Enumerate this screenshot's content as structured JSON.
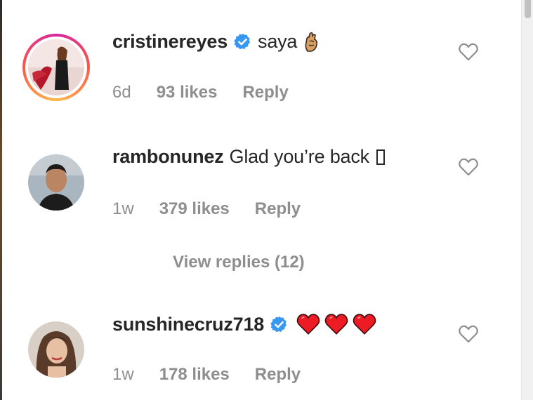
{
  "comments": [
    {
      "username": "cristinereyes",
      "verified": true,
      "text": "saya",
      "emoji": "finger-crossed-emoji",
      "age": "6d",
      "likes": "93 likes",
      "reply": "Reply",
      "story_ring": true
    },
    {
      "username": "rambonunez",
      "verified": false,
      "text": "Glad you’re back",
      "emoji": "missing-glyph",
      "age": "1w",
      "likes": "379 likes",
      "reply": "Reply",
      "story_ring": false
    },
    {
      "username": "sunshinecruz718",
      "verified": true,
      "text": "",
      "emoji": "three-red-hearts-emoji",
      "age": "1w",
      "likes": "178 likes",
      "reply": "Reply",
      "story_ring": false
    }
  ],
  "view_replies": "View replies (12)",
  "colors": {
    "text": "#262626",
    "muted": "#8e8e8e",
    "verified_blue": "#3897f0",
    "heart_red": "#ed1c24"
  }
}
